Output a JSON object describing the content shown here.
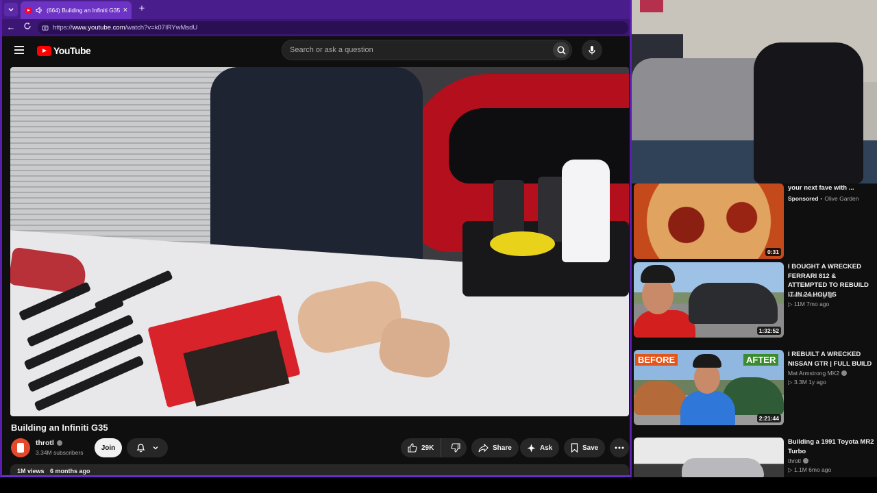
{
  "browser": {
    "tab_title": "(664) Building an Infiniti G35",
    "url_prefix": "https://",
    "url_domain": "www.youtube.com",
    "url_path": "/watch?v=k07IRYwMsdU",
    "accent_color": "#5b1fb0"
  },
  "header": {
    "logo_text": "YouTube",
    "search_placeholder": "Search or ask a question"
  },
  "video": {
    "title": "Building an Infiniti G35",
    "channel": "throtl",
    "subscribers": "3.34M subscribers",
    "join_label": "Join",
    "likes": "29K",
    "share_label": "Share",
    "ask_label": "Ask",
    "save_label": "Save",
    "views": "1M views",
    "age": "6 months ago"
  },
  "recommendations": [
    {
      "title": "your next fave with ...",
      "sponsored_label": "Sponsored",
      "channel": "Olive Garden",
      "duration": "0:31"
    },
    {
      "title": "I BOUGHT A WRECKED FERRARI 812 & ATTEMPTED TO REBUILD IT IN 24 HOURS",
      "channel": "Mat Armstrong",
      "meta": "11M  7mo ago",
      "duration": "1:32:52"
    },
    {
      "title": "I REBUILT A WRECKED NISSAN GTR | FULL BUILD",
      "channel": "Mat Armstrong MK2",
      "meta": "3.3M  1y ago",
      "duration": "2:21:44",
      "thumb_before": "BEFORE",
      "thumb_after": "AFTER"
    },
    {
      "title": "Building a 1991 Toyota MR2 Turbo",
      "channel": "throtl",
      "meta": "1.1M  6mo ago"
    }
  ]
}
